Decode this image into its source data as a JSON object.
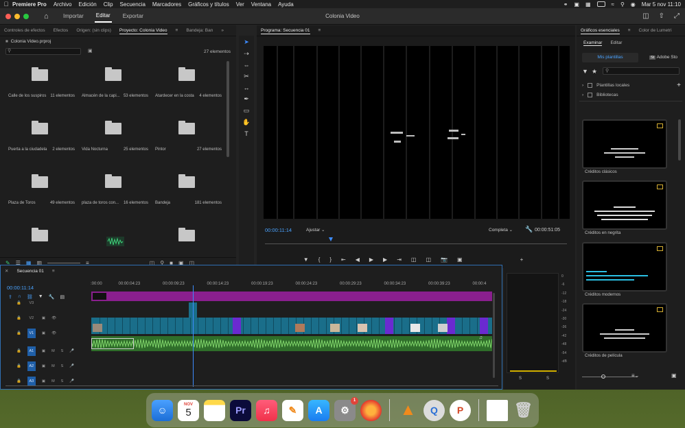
{
  "menubar": {
    "app": "Premiere Pro",
    "items": [
      "Archivo",
      "Edición",
      "Clip",
      "Secuencia",
      "Marcadores",
      "Gráficos y títulos",
      "Ver",
      "Ventana",
      "Ayuda"
    ],
    "clock": "Mar 5 nov  11:10"
  },
  "window": {
    "tabs": [
      "Importar",
      "Editar",
      "Exportar"
    ],
    "title": "Colonia Video"
  },
  "project_panel": {
    "tabs": [
      "Controles de efectos",
      "Efectos",
      "Origen: (sin clips)",
      "Proyecto: Colonia Video",
      "Bandeja: Ban"
    ],
    "file": "Colonia Video.prproj",
    "item_count": "27 elementos",
    "bins": [
      {
        "name": "Calle de los suspiros",
        "count": "11 elementos"
      },
      {
        "name": "Almacén de la capi...",
        "count": "53 elementos"
      },
      {
        "name": "Atardecer en la costa",
        "count": "4 elementos"
      },
      {
        "name": "Puerta a la ciudadela",
        "count": "2 elementos"
      },
      {
        "name": "Vida Nocturna",
        "count": "25 elementos"
      },
      {
        "name": "Pintor",
        "count": "27 elementos"
      },
      {
        "name": "Plaza de Toros",
        "count": "49 elementos"
      },
      {
        "name": "plaza de toros con...",
        "count": "16 elementos"
      },
      {
        "name": "Bandeja",
        "count": "181 elementos"
      }
    ]
  },
  "program_monitor": {
    "tab": "Programa: Secuencia 01",
    "timecode": "00:00:11:14",
    "fit": "Ajustar",
    "quality": "Completa",
    "duration": "00:00:51:05"
  },
  "essential_graphics": {
    "tabs": [
      "Gráficos esenciales",
      "Color de Lumetri"
    ],
    "subtabs": [
      "Examinar",
      "Editar"
    ],
    "my_templates": "Mis plantillas",
    "adobe_stock": "Adobe Sto",
    "folders": [
      "Plantillas locales",
      "Bibliotecas"
    ],
    "templates": [
      "Créditos clásicos",
      "Créditos en negrita",
      "Créditos modernos",
      "Créditos de película"
    ]
  },
  "timeline": {
    "tab": "Secuencia 01",
    "timecode": "00:00:11:14",
    "ruler": [
      ":00:00",
      "00:00:04:23",
      "00:00:09:23",
      "00:00:14:23",
      "00:00:19:23",
      "00:00:24:23",
      "00:00:29:23",
      "00:00:34:23",
      "00:00:39:23",
      "00:00:4"
    ],
    "video_tracks": [
      "V3",
      "V2",
      "V1"
    ],
    "audio_tracks": [
      "A1",
      "A2",
      "A3"
    ],
    "playhead_fraction": 0.255
  },
  "audio_meter": {
    "scale": [
      "0",
      "-6",
      "-12",
      "-18",
      "-24",
      "-30",
      "-36",
      "-42",
      "-48",
      "-54",
      "-dB"
    ],
    "solo": [
      "S",
      "S"
    ]
  },
  "dock": {
    "calendar_month": "NOV",
    "calendar_day": "5",
    "settings_badge": "1",
    "apps": [
      "Finder",
      "Calendario",
      "Notas",
      "Premiere Pro",
      "Música",
      "Pages",
      "App Store",
      "Configuración",
      "Firefox",
      "VLC",
      "QuickTime",
      "PowerPoint",
      "Documento",
      "Papelera"
    ]
  },
  "colors": {
    "accent_blue": "#4aa3ff",
    "clip_purple": "#8a1f8e",
    "clip_teal": "#1a6e8a",
    "clip_green": "#2f6e2a"
  }
}
